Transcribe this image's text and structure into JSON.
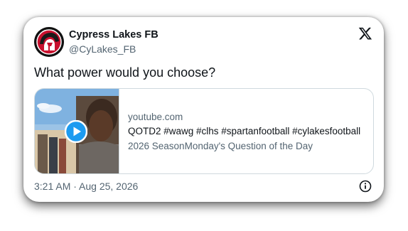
{
  "author": {
    "display_name": "Cypress Lakes FB",
    "handle": "@CyLakes_FB",
    "avatar_icon": "cypress-lakes-spartan-logo"
  },
  "platform_icon": "x-logo-icon",
  "tweet": {
    "text": "What power would you choose?"
  },
  "link_card": {
    "domain": "youtube.com",
    "title": "QOTD2 #wawg #clhs #spartanfootball #cylakesfootball",
    "description": "2026 SeasonMonday's Question of the Day",
    "media_icon": "play-icon"
  },
  "timestamp": "3:21 AM · Aug 25, 2026",
  "info_icon": "info-icon",
  "colors": {
    "text_primary": "#0f1419",
    "text_secondary": "#536471",
    "border": "#cfd9de",
    "play_blue": "#1d9bf0",
    "avatar_red": "#c8102e"
  }
}
